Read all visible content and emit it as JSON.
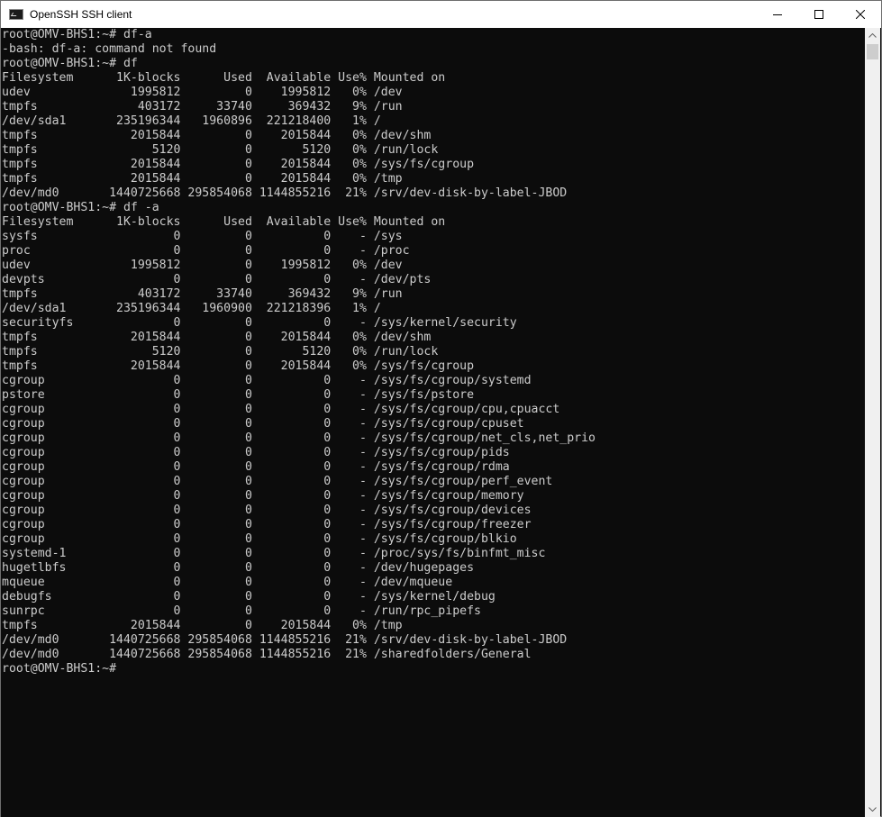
{
  "window": {
    "title": "OpenSSH SSH client",
    "app_icon": "console-icon",
    "controls": {
      "minimize_icon": "minimize-icon",
      "maximize_icon": "maximize-icon",
      "close_icon": "close-icon"
    }
  },
  "terminal": {
    "background": "#0c0c0c",
    "foreground": "#cccccc",
    "lines": [
      "root@OMV-BHS1:~# df-a",
      "-bash: df-a: command not found",
      "root@OMV-BHS1:~# df",
      "Filesystem      1K-blocks      Used  Available Use% Mounted on",
      "udev              1995812         0    1995812   0% /dev",
      "tmpfs              403172     33740     369432   9% /run",
      "/dev/sda1       235196344   1960896  221218400   1% /",
      "tmpfs             2015844         0    2015844   0% /dev/shm",
      "tmpfs                5120         0       5120   0% /run/lock",
      "tmpfs             2015844         0    2015844   0% /sys/fs/cgroup",
      "tmpfs             2015844         0    2015844   0% /tmp",
      "/dev/md0       1440725668 295854068 1144855216  21% /srv/dev-disk-by-label-JBOD",
      "root@OMV-BHS1:~# df -a",
      "Filesystem      1K-blocks      Used  Available Use% Mounted on",
      "sysfs                   0         0          0    - /sys",
      "proc                    0         0          0    - /proc",
      "udev              1995812         0    1995812   0% /dev",
      "devpts                  0         0          0    - /dev/pts",
      "tmpfs              403172     33740     369432   9% /run",
      "/dev/sda1       235196344   1960900  221218396   1% /",
      "securityfs              0         0          0    - /sys/kernel/security",
      "tmpfs             2015844         0    2015844   0% /dev/shm",
      "tmpfs                5120         0       5120   0% /run/lock",
      "tmpfs             2015844         0    2015844   0% /sys/fs/cgroup",
      "cgroup                  0         0          0    - /sys/fs/cgroup/systemd",
      "pstore                  0         0          0    - /sys/fs/pstore",
      "cgroup                  0         0          0    - /sys/fs/cgroup/cpu,cpuacct",
      "cgroup                  0         0          0    - /sys/fs/cgroup/cpuset",
      "cgroup                  0         0          0    - /sys/fs/cgroup/net_cls,net_prio",
      "cgroup                  0         0          0    - /sys/fs/cgroup/pids",
      "cgroup                  0         0          0    - /sys/fs/cgroup/rdma",
      "cgroup                  0         0          0    - /sys/fs/cgroup/perf_event",
      "cgroup                  0         0          0    - /sys/fs/cgroup/memory",
      "cgroup                  0         0          0    - /sys/fs/cgroup/devices",
      "cgroup                  0         0          0    - /sys/fs/cgroup/freezer",
      "cgroup                  0         0          0    - /sys/fs/cgroup/blkio",
      "systemd-1               0         0          0    - /proc/sys/fs/binfmt_misc",
      "hugetlbfs               0         0          0    - /dev/hugepages",
      "mqueue                  0         0          0    - /dev/mqueue",
      "debugfs                 0         0          0    - /sys/kernel/debug",
      "sunrpc                  0         0          0    - /run/rpc_pipefs",
      "tmpfs             2015844         0    2015844   0% /tmp",
      "/dev/md0       1440725668 295854068 1144855216  21% /srv/dev-disk-by-label-JBOD",
      "/dev/md0       1440725668 295854068 1144855216  21% /sharedfolders/General"
    ],
    "prompt": "root@OMV-BHS1:~# "
  },
  "scrollbar": {
    "up_icon": "scroll-up-arrow-icon",
    "down_icon": "scroll-down-arrow-icon",
    "position": 0
  }
}
